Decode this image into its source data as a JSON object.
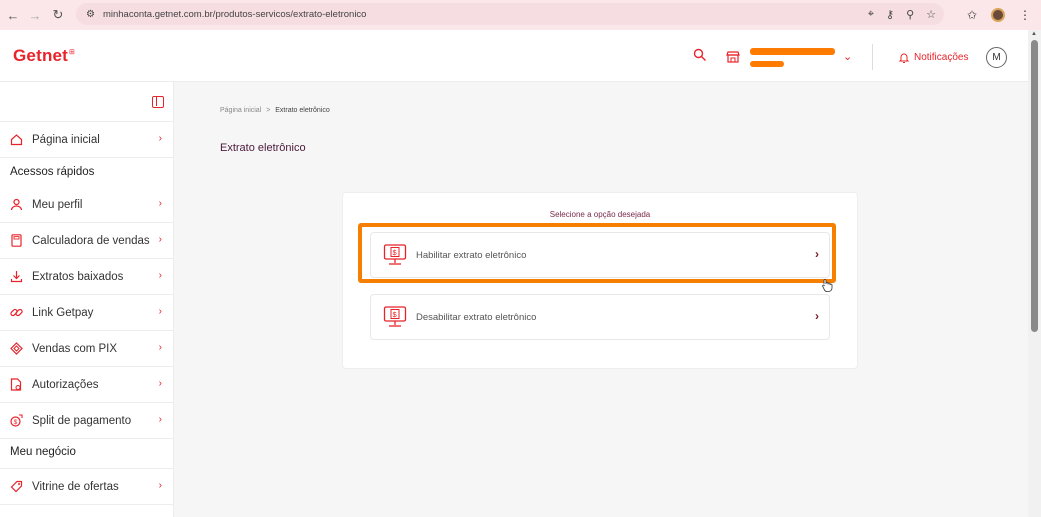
{
  "browser": {
    "url": "minhaconta.getnet.com.br/produtos-servicos/extrato-eletronico",
    "profile_initial": ""
  },
  "header": {
    "logo": "Getnet",
    "notifications_label": "Notificações",
    "avatar_initial": "M"
  },
  "sidebar": {
    "home": "Página inicial",
    "section_quick": "Acessos rápidos",
    "quick_items": [
      {
        "label": "Meu perfil",
        "icon": "user-icon"
      },
      {
        "label": "Calculadora de vendas",
        "icon": "calculator-icon"
      },
      {
        "label": "Extratos baixados",
        "icon": "download-icon"
      },
      {
        "label": "Link Getpay",
        "icon": "link-icon"
      },
      {
        "label": "Vendas com PIX",
        "icon": "pix-icon"
      },
      {
        "label": "Autorizações",
        "icon": "document-icon"
      },
      {
        "label": "Split de pagamento",
        "icon": "split-icon"
      }
    ],
    "section_business": "Meu negócio",
    "business_items": [
      {
        "label": "Vitrine de ofertas",
        "icon": "tag-icon"
      }
    ]
  },
  "main": {
    "breadcrumb_home": "Página inicial",
    "breadcrumb_sep": ">",
    "breadcrumb_current": "Extrato eletrônico",
    "title": "Extrato eletrônico",
    "card_title": "Selecione a opção desejada",
    "options": [
      {
        "label": "Habilitar extrato eletrônico"
      },
      {
        "label": "Desabilitar extrato eletrônico"
      }
    ]
  },
  "colors": {
    "brand": "#e8232a",
    "highlight": "#f77f00"
  }
}
